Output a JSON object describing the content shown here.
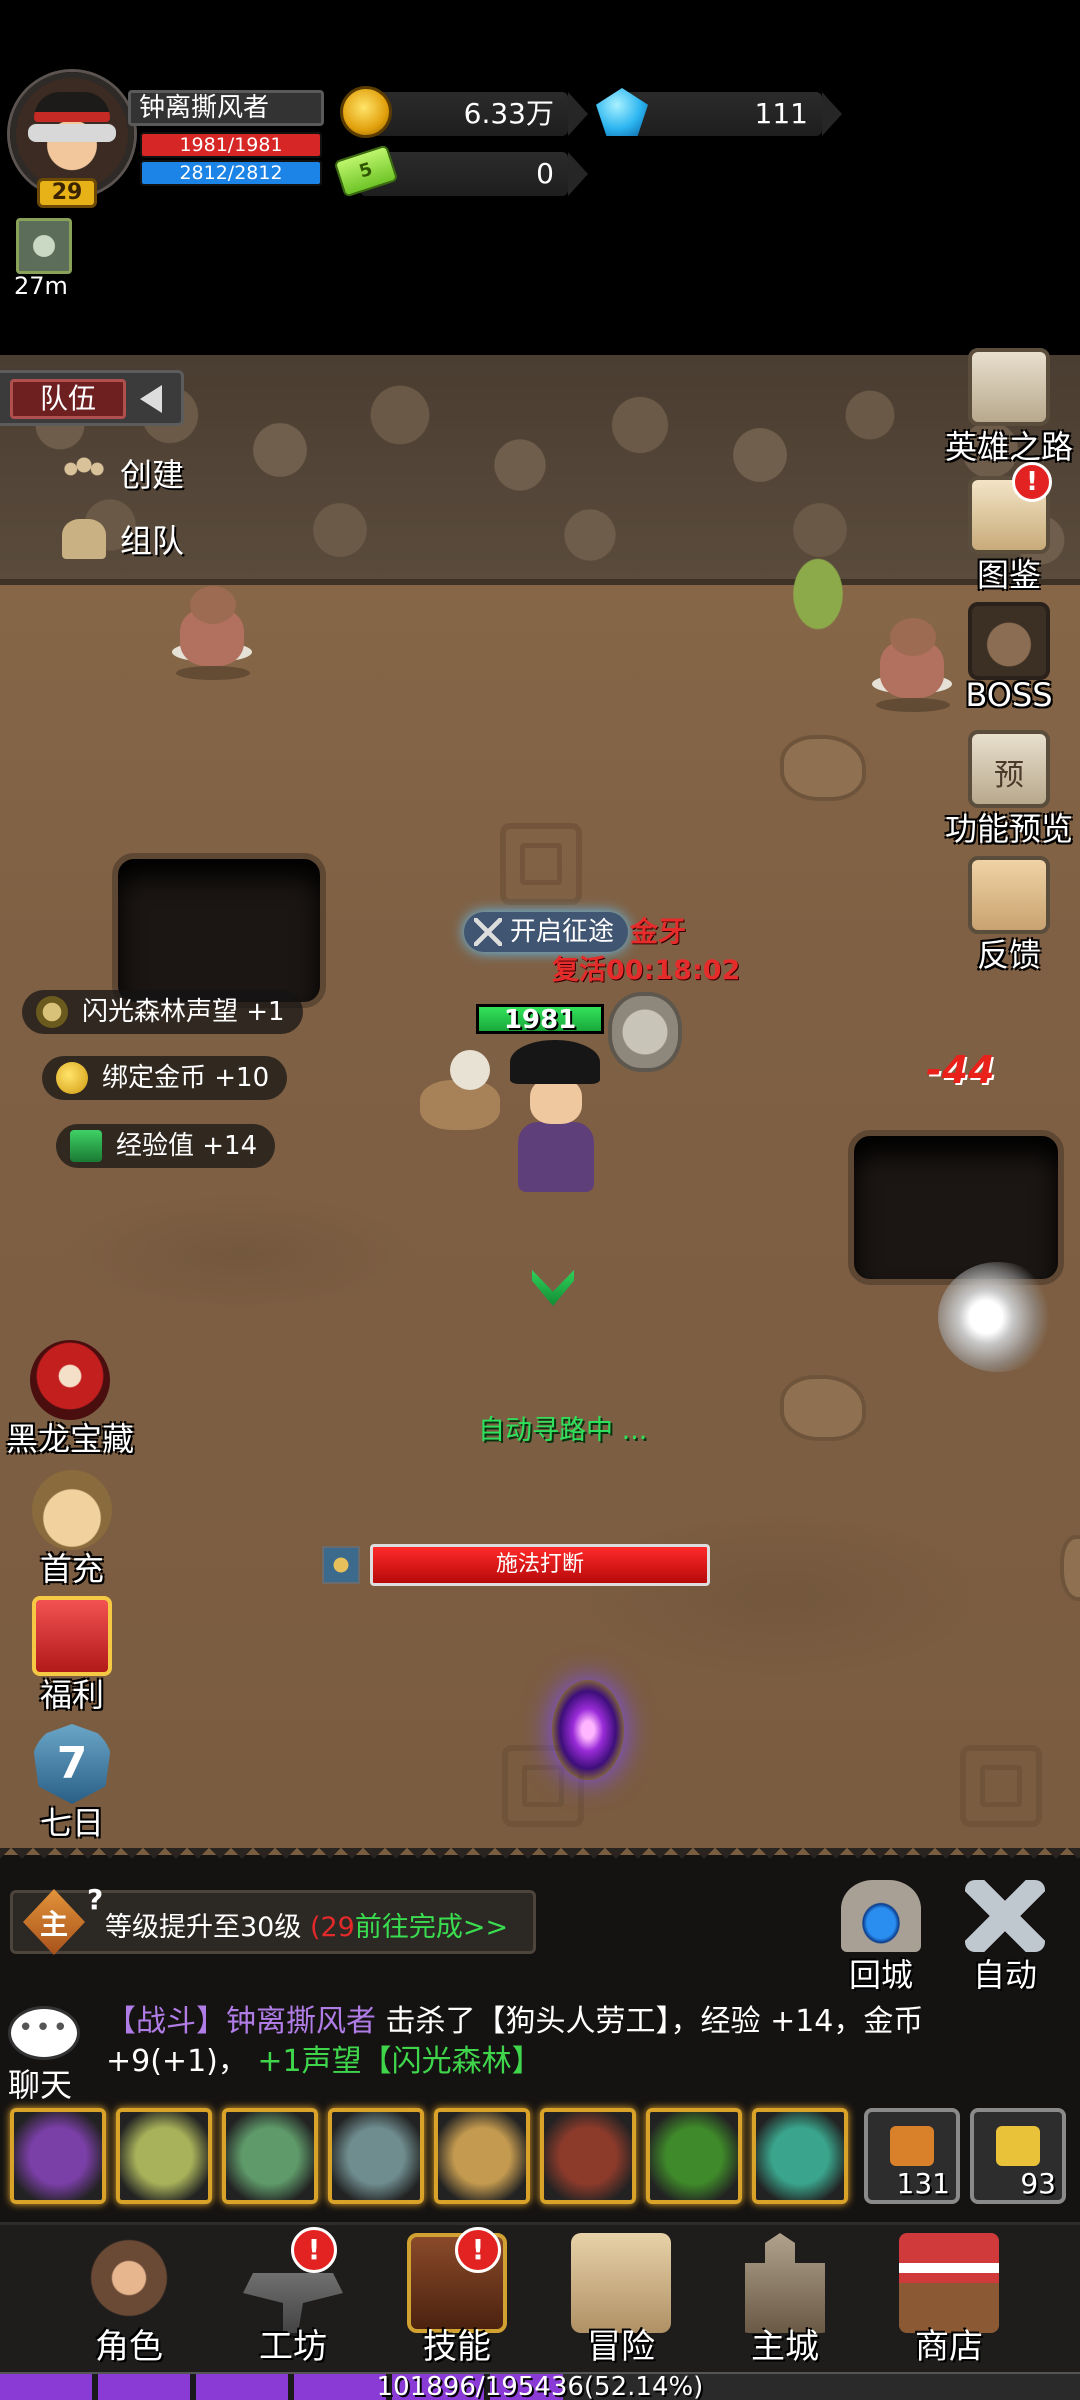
{
  "player": {
    "name": "钟离撕风者",
    "level": "29",
    "hp": "1981/1981",
    "mp": "2812/2812",
    "hp_floating": "1981",
    "hp_fraction": 1.0
  },
  "resources": {
    "gold": "6.33万",
    "gems": "111",
    "tickets": "0",
    "ticket_icon_text": "5"
  },
  "buff": {
    "icon": "skull-buff-icon",
    "timer": "27m"
  },
  "team": {
    "tab_label": "队伍",
    "actions": [
      {
        "label": "创建",
        "icon": "people-icon"
      },
      {
        "label": "组队",
        "icon": "helmet-icon"
      }
    ]
  },
  "right_menu": [
    {
      "label": "英雄之路",
      "icon": "banner-icon",
      "badge": ""
    },
    {
      "label": "图鉴",
      "icon": "book-icon",
      "badge": "!"
    },
    {
      "label": "BOSS",
      "icon": "boss-horn-icon",
      "badge": ""
    },
    {
      "label": "功能预览",
      "icon": "preview-scroll-icon",
      "badge": ""
    },
    {
      "label": "反馈",
      "icon": "feedback-envelope-icon",
      "badge": ""
    }
  ],
  "toasts": [
    {
      "text": "闪光森林声望 +1",
      "icon": "reputation-icon"
    },
    {
      "text": "绑定金币 +10",
      "icon": "bound-gold-icon"
    },
    {
      "text": "经验值 +14",
      "icon": "exp-icon"
    }
  ],
  "left_menu": [
    {
      "label": "黑龙宝藏",
      "icon": "dragon-treasure-icon"
    },
    {
      "label": "首充",
      "icon": "first-charge-icon"
    },
    {
      "label": "福利",
      "icon": "gift-icon"
    },
    {
      "label": "七日",
      "icon": "seven-day-icon",
      "icon_text": "7"
    }
  ],
  "battle": {
    "quest_marker": "开启征途",
    "enemy_name": "金牙",
    "revive_timer": "复活00:18:02",
    "damage": "-44",
    "auto_path": "自动寻路中 ...",
    "cast_label": "施法打断"
  },
  "quest": {
    "emblem": "主",
    "help": "?",
    "text": "等级提升至30级 ",
    "progress": "(29",
    "go": "前往完成>>"
  },
  "hud_buttons": [
    {
      "label": "回城",
      "icon": "return-portal-icon"
    },
    {
      "label": "自动",
      "icon": "crossed-swords-icon"
    }
  ],
  "chat": {
    "label": "聊天",
    "tag": "【战斗】",
    "name": "钟离撕风者",
    "part1": " 击杀了【狗头人劳工】，经验 +14，金币 +9(+1)，",
    "part2": " +1声望【闪光森林】"
  },
  "skills": [
    {
      "icon": "green-slash-skill-icon",
      "color": "#7b3fa8"
    },
    {
      "icon": "beast-roar-skill-icon",
      "color": "#a8b25a"
    },
    {
      "icon": "stone-face-skill-icon",
      "color": "#5f9a6a"
    },
    {
      "icon": "skull-beast-skill-icon",
      "color": "#6f8c8e"
    },
    {
      "icon": "claw-skill-icon",
      "color": "#c39a4f"
    },
    {
      "icon": "spinning-blade-skill-icon",
      "color": "#8c3b2b"
    },
    {
      "icon": "green-orb-skill-icon",
      "color": "#3f8a2a"
    },
    {
      "icon": "spirit-skill-icon",
      "color": "#3aa58c"
    }
  ],
  "items": [
    {
      "icon": "bread-item-icon",
      "count": "131",
      "color": "#d9802a"
    },
    {
      "icon": "drink-item-icon",
      "count": "93",
      "color": "#e9c23a"
    }
  ],
  "nav": [
    {
      "label": "角色",
      "icon": "character-icon",
      "badge": ""
    },
    {
      "label": "工坊",
      "icon": "anvil-icon",
      "badge": "!"
    },
    {
      "label": "技能",
      "icon": "skill-book-icon",
      "badge": "!"
    },
    {
      "label": "冒险",
      "icon": "map-scroll-icon",
      "badge": ""
    },
    {
      "label": "主城",
      "icon": "castle-icon",
      "badge": ""
    },
    {
      "label": "商店",
      "icon": "shop-icon",
      "badge": ""
    }
  ],
  "exp": {
    "text": "101896/195436(52.14%)",
    "fraction": 0.5214
  }
}
